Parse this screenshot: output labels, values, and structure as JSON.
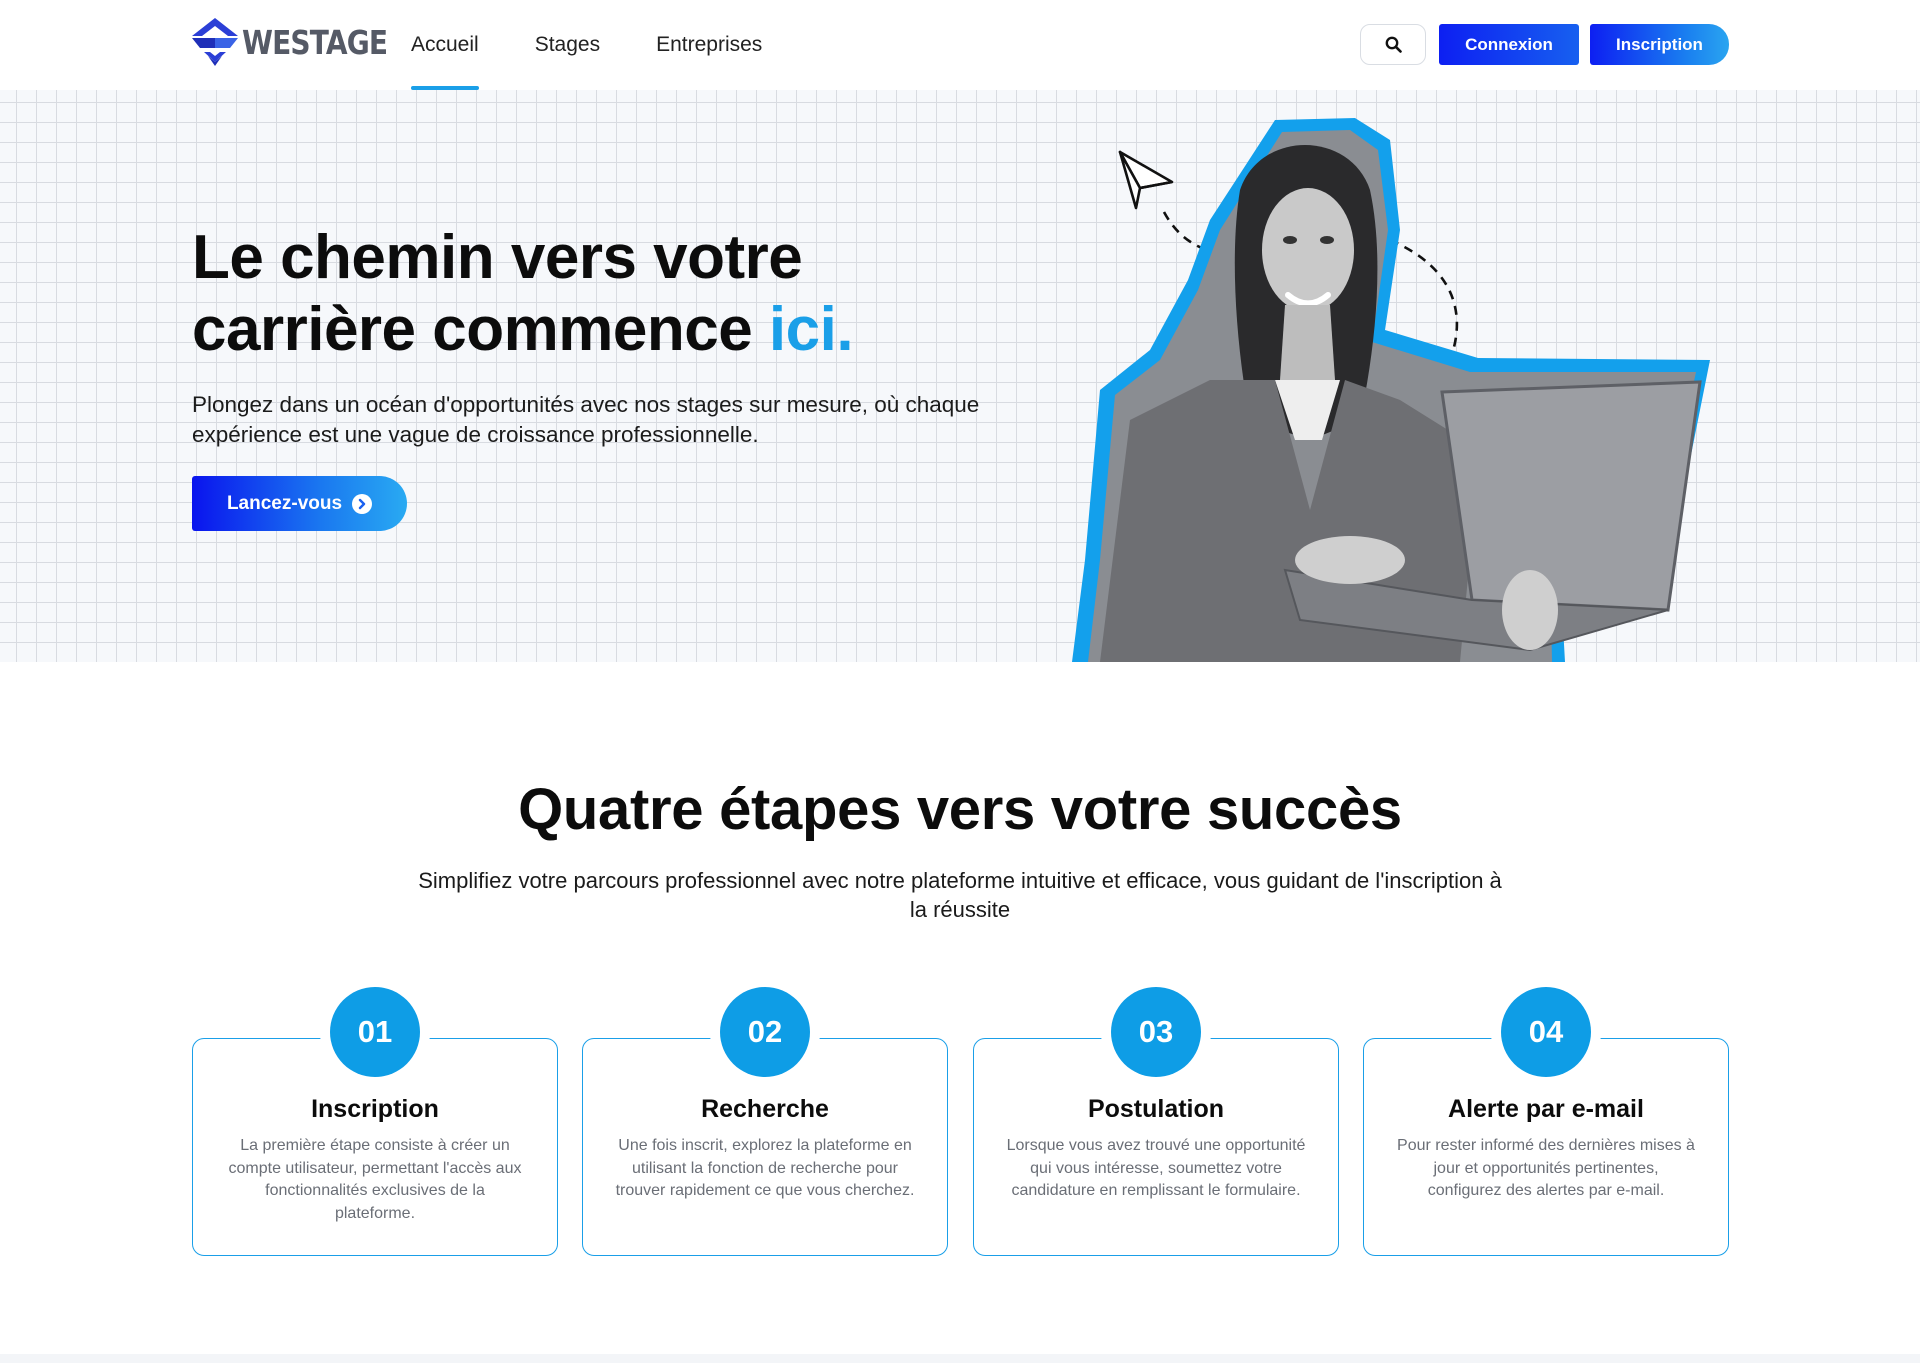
{
  "brand": {
    "name": "WESTAGE"
  },
  "nav": {
    "items": [
      {
        "label": "Accueil",
        "active": true
      },
      {
        "label": "Stages",
        "active": false
      },
      {
        "label": "Entreprises",
        "active": false
      }
    ]
  },
  "header": {
    "search_icon": "search-icon",
    "login_label": "Connexion",
    "signup_label": "Inscription"
  },
  "hero": {
    "title_line1": "Le chemin vers votre",
    "title_line2": "carrière commence ",
    "title_accent": "ici.",
    "subtitle": "Plongez dans un océan d'opportunités avec nos stages sur mesure, où chaque expérience est une vague de croissance professionnelle.",
    "cta_label": "Lancez-vous",
    "cta_icon": "chevron-right-circle-icon"
  },
  "steps": {
    "title": "Quatre étapes vers votre succès",
    "subtitle": "Simplifiez votre parcours professionnel avec notre plateforme intuitive et efficace, vous guidant de l'inscription à la réussite",
    "cards": [
      {
        "number": "01",
        "title": "Inscription",
        "text": "La première étape consiste à créer un compte utilisateur, permettant l'accès aux fonctionnalités exclusives de la plateforme."
      },
      {
        "number": "02",
        "title": "Recherche",
        "text": "Une fois inscrit, explorez la plateforme en utilisant la fonction de recherche pour trouver rapidement ce que vous cherchez."
      },
      {
        "number": "03",
        "title": "Postulation",
        "text": "Lorsque vous avez trouvé une opportunité qui vous intéresse, soumettez votre candidature en remplissant le formulaire."
      },
      {
        "number": "04",
        "title": "Alerte par e-mail",
        "text": "Pour rester informé des dernières mises à jour et opportunités pertinentes, configurez des alertes par e-mail."
      }
    ]
  },
  "colors": {
    "accent": "#1a9fe8",
    "primary_blue": "#0d1ff2",
    "step_circle": "#0e9de6"
  }
}
